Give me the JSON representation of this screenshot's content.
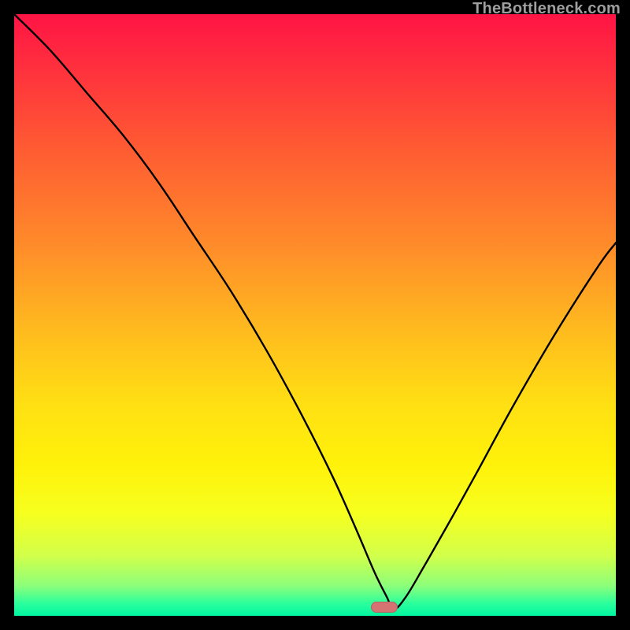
{
  "watermark": {
    "text": "TheBottleneck.com"
  },
  "colors": {
    "frame_bg": "#000000",
    "curve": "#000000",
    "marker": "#d57272",
    "watermark": "#9f9f9f"
  },
  "marker": {
    "x_pct": 61.5,
    "y_pct": 98.5
  },
  "chart_data": {
    "type": "line",
    "title": "",
    "xlabel": "",
    "ylabel": "",
    "xlim": [
      0,
      100
    ],
    "ylim": [
      0,
      100
    ],
    "grid": false,
    "legend": false,
    "series": [
      {
        "name": "bottleneck-curve",
        "x": [
          0,
          6,
          12,
          18,
          24,
          30,
          36,
          42,
          48,
          53,
          57,
          60,
          62,
          63,
          65,
          68,
          72,
          77,
          83,
          90,
          97,
          100
        ],
        "y": [
          100,
          94,
          87,
          80,
          72,
          63,
          54,
          44,
          33,
          23,
          14,
          7,
          3,
          1,
          3,
          8,
          15,
          24,
          35,
          47,
          58,
          62
        ]
      }
    ],
    "annotations": [
      {
        "kind": "marker",
        "shape": "rounded-rect",
        "x": 61.5,
        "y": 1.5,
        "label": "optimal-point"
      }
    ],
    "background_gradient": {
      "direction": "vertical",
      "stops": [
        {
          "pos": 0.0,
          "color": "#ff1445"
        },
        {
          "pos": 0.5,
          "color": "#ffc61a"
        },
        {
          "pos": 0.8,
          "color": "#f8ff12"
        },
        {
          "pos": 1.0,
          "color": "#00f5a0"
        }
      ]
    }
  }
}
